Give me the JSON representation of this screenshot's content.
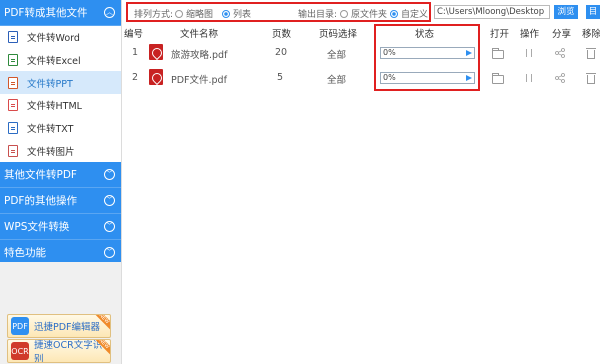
{
  "sidebar": {
    "sections": [
      {
        "label": "PDF转成其他文件"
      },
      {
        "label": "其他文件转PDF"
      },
      {
        "label": "PDF的其他操作"
      },
      {
        "label": "WPS文件转换"
      },
      {
        "label": "特色功能"
      }
    ],
    "sub_items": [
      {
        "label": "文件转Word",
        "icon": "word-doc-icon"
      },
      {
        "label": "文件转Excel",
        "icon": "excel-doc-icon"
      },
      {
        "label": "文件转PPT",
        "icon": "ppt-doc-icon",
        "active": true
      },
      {
        "label": "文件转HTML",
        "icon": "html-doc-icon"
      },
      {
        "label": "文件转TXT",
        "icon": "txt-doc-icon"
      },
      {
        "label": "文件转图片",
        "icon": "image-doc-icon"
      }
    ],
    "promos": [
      {
        "label": "迅捷PDF编辑器",
        "icon": "pdf-editor-icon",
        "icon_text": "PDF",
        "badge": "NEW"
      },
      {
        "label": "捷速OCR文字识别",
        "icon": "ocr-icon",
        "icon_text": "OCR",
        "badge": "NEW"
      }
    ]
  },
  "toolbar": {
    "arrange_label": "排列方式:",
    "thumbnail_label": "缩略图",
    "list_label": "列表",
    "arrange_selected": "列表",
    "output_label": "输出目录:",
    "original_folder_label": "原文件夹",
    "custom_label": "自定义",
    "output_selected": "自定义",
    "path_value": "C:\\Users\\Mloong\\Desktop",
    "browse_label": "浏览",
    "open_dir_label": "目"
  },
  "table": {
    "columns": [
      "编号",
      "文件名称",
      "页数",
      "页码选择",
      "状态",
      "打开",
      "操作",
      "分享",
      "移除"
    ],
    "rows": [
      {
        "index": "1",
        "name": "旅游攻略.pdf",
        "pages": "20",
        "range": "全部",
        "progress": "0%",
        "progress_value": 0
      },
      {
        "index": "2",
        "name": "PDF文件.pdf",
        "pages": "5",
        "range": "全部",
        "progress": "0%",
        "progress_value": 0
      }
    ]
  },
  "colors": {
    "accent": "#2e8ff0",
    "highlight": "#e02020",
    "active_item_bg": "#d6e9fb"
  }
}
